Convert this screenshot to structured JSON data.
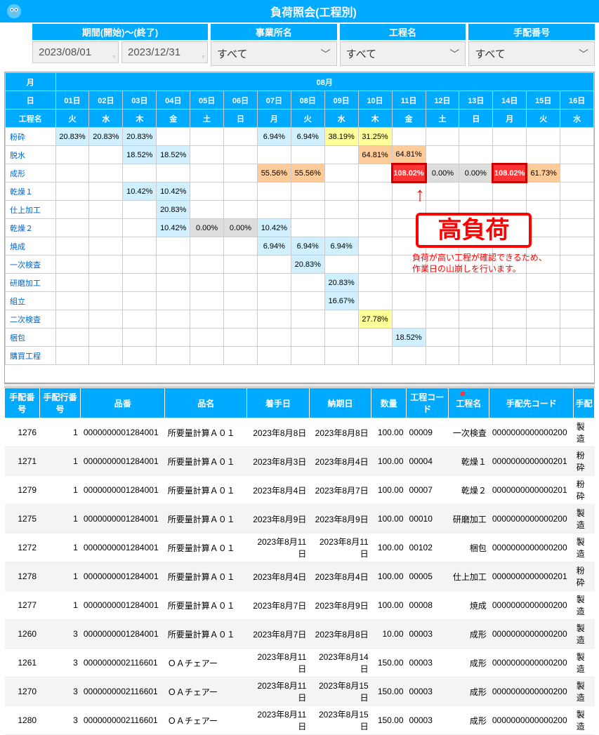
{
  "title": "負荷照会(工程別)",
  "filters": {
    "period_label": "期間(開始)～(終了)",
    "period_start": "2023/08/01",
    "period_end": "2023/12/31",
    "office_label": "事業所名",
    "office_value": "すべて",
    "process_label": "工程名",
    "process_value": "すべて",
    "order_label": "手配番号",
    "order_value": "すべて"
  },
  "calendar": {
    "month_header": "月",
    "month_value": "08月",
    "day_header": "日",
    "proc_header": "工程名",
    "days": [
      "01日",
      "02日",
      "03日",
      "04日",
      "05日",
      "06日",
      "07日",
      "08日",
      "09日",
      "10日",
      "11日",
      "12日",
      "13日",
      "14日",
      "15日",
      "16日"
    ],
    "dows": [
      "火",
      "水",
      "木",
      "金",
      "土",
      "日",
      "月",
      "火",
      "水",
      "木",
      "金",
      "土",
      "日",
      "月",
      "火",
      "水"
    ]
  },
  "rows": [
    {
      "name": "粉砕",
      "cells": [
        [
          "20.83%",
          "c-ltblue"
        ],
        [
          "20.83%",
          "c-ltblue"
        ],
        [
          "20.83%",
          "c-ltblue"
        ],
        [
          "",
          ""
        ],
        [
          "",
          ""
        ],
        [
          "",
          ""
        ],
        [
          "6.94%",
          "c-ltblue"
        ],
        [
          "6.94%",
          "c-ltblue"
        ],
        [
          "38.19%",
          "c-yellow"
        ],
        [
          "31.25%",
          "c-yellow"
        ],
        [
          "",
          ""
        ],
        [
          "",
          ""
        ],
        [
          "",
          ""
        ],
        [
          "",
          ""
        ],
        [
          "",
          ""
        ],
        [
          "",
          ""
        ]
      ]
    },
    {
      "name": "脱水",
      "cells": [
        [
          "",
          ""
        ],
        [
          "",
          ""
        ],
        [
          "18.52%",
          "c-ltblue"
        ],
        [
          "18.52%",
          "c-ltblue"
        ],
        [
          "",
          ""
        ],
        [
          "",
          ""
        ],
        [
          "",
          ""
        ],
        [
          "",
          ""
        ],
        [
          "",
          ""
        ],
        [
          "64.81%",
          "c-orange"
        ],
        [
          "64.81%",
          "c-orange"
        ],
        [
          "",
          ""
        ],
        [
          "",
          ""
        ],
        [
          "",
          ""
        ],
        [
          "",
          ""
        ],
        [
          "",
          ""
        ]
      ]
    },
    {
      "name": "成形",
      "cells": [
        [
          "",
          ""
        ],
        [
          "",
          ""
        ],
        [
          "",
          ""
        ],
        [
          "",
          ""
        ],
        [
          "",
          ""
        ],
        [
          "",
          ""
        ],
        [
          "55.56%",
          "c-orange"
        ],
        [
          "55.56%",
          "c-orange"
        ],
        [
          "",
          ""
        ],
        [
          "",
          ""
        ],
        [
          "108.02%",
          "c-red"
        ],
        [
          "0.00%",
          "c-gray"
        ],
        [
          "0.00%",
          "c-gray"
        ],
        [
          "108.02%",
          "c-red"
        ],
        [
          "61.73%",
          "c-orange"
        ],
        [
          "",
          ""
        ]
      ]
    },
    {
      "name": "乾燥１",
      "cells": [
        [
          "",
          ""
        ],
        [
          "",
          ""
        ],
        [
          "10.42%",
          "c-ltblue"
        ],
        [
          "10.42%",
          "c-ltblue"
        ],
        [
          "",
          ""
        ],
        [
          "",
          ""
        ],
        [
          "",
          ""
        ],
        [
          "",
          ""
        ],
        [
          "",
          ""
        ],
        [
          "",
          ""
        ],
        [
          "",
          ""
        ],
        [
          "",
          ""
        ],
        [
          "",
          ""
        ],
        [
          "",
          ""
        ],
        [
          "",
          ""
        ],
        [
          "",
          ""
        ]
      ]
    },
    {
      "name": "仕上加工",
      "cells": [
        [
          "",
          ""
        ],
        [
          "",
          ""
        ],
        [
          "",
          ""
        ],
        [
          "20.83%",
          "c-ltblue"
        ],
        [
          "",
          ""
        ],
        [
          "",
          ""
        ],
        [
          "",
          ""
        ],
        [
          "",
          ""
        ],
        [
          "",
          ""
        ],
        [
          "",
          ""
        ],
        [
          "",
          ""
        ],
        [
          "",
          ""
        ],
        [
          "",
          ""
        ],
        [
          "",
          ""
        ],
        [
          "",
          ""
        ],
        [
          "",
          ""
        ]
      ]
    },
    {
      "name": "乾燥２",
      "cells": [
        [
          "",
          ""
        ],
        [
          "",
          ""
        ],
        [
          "",
          ""
        ],
        [
          "10.42%",
          "c-ltblue"
        ],
        [
          "0.00%",
          "c-gray"
        ],
        [
          "0.00%",
          "c-gray"
        ],
        [
          "10.42%",
          "c-ltblue"
        ],
        [
          "",
          ""
        ],
        [
          "",
          ""
        ],
        [
          "",
          ""
        ],
        [
          "",
          ""
        ],
        [
          "",
          ""
        ],
        [
          "",
          ""
        ],
        [
          "",
          ""
        ],
        [
          "",
          ""
        ],
        [
          "",
          ""
        ]
      ]
    },
    {
      "name": "焼成",
      "cells": [
        [
          "",
          ""
        ],
        [
          "",
          ""
        ],
        [
          "",
          ""
        ],
        [
          "",
          ""
        ],
        [
          "",
          ""
        ],
        [
          "",
          ""
        ],
        [
          "6.94%",
          "c-ltblue"
        ],
        [
          "6.94%",
          "c-ltblue"
        ],
        [
          "6.94%",
          "c-ltblue"
        ],
        [
          "",
          ""
        ],
        [
          "",
          ""
        ],
        [
          "",
          ""
        ],
        [
          "",
          ""
        ],
        [
          "",
          ""
        ],
        [
          "",
          ""
        ],
        [
          "",
          ""
        ]
      ]
    },
    {
      "name": "一次検査",
      "cells": [
        [
          "",
          ""
        ],
        [
          "",
          ""
        ],
        [
          "",
          ""
        ],
        [
          "",
          ""
        ],
        [
          "",
          ""
        ],
        [
          "",
          ""
        ],
        [
          "",
          ""
        ],
        [
          "20.83%",
          "c-ltblue"
        ],
        [
          "",
          ""
        ],
        [
          "",
          ""
        ],
        [
          "",
          ""
        ],
        [
          "",
          ""
        ],
        [
          "",
          ""
        ],
        [
          "",
          ""
        ],
        [
          "",
          ""
        ],
        [
          "",
          ""
        ]
      ]
    },
    {
      "name": "研磨加工",
      "cells": [
        [
          "",
          ""
        ],
        [
          "",
          ""
        ],
        [
          "",
          ""
        ],
        [
          "",
          ""
        ],
        [
          "",
          ""
        ],
        [
          "",
          ""
        ],
        [
          "",
          ""
        ],
        [
          "",
          ""
        ],
        [
          "20.83%",
          "c-ltblue"
        ],
        [
          "",
          ""
        ],
        [
          "",
          ""
        ],
        [
          "",
          ""
        ],
        [
          "",
          ""
        ],
        [
          "",
          ""
        ],
        [
          "",
          ""
        ],
        [
          "",
          ""
        ]
      ]
    },
    {
      "name": "組立",
      "cells": [
        [
          "",
          ""
        ],
        [
          "",
          ""
        ],
        [
          "",
          ""
        ],
        [
          "",
          ""
        ],
        [
          "",
          ""
        ],
        [
          "",
          ""
        ],
        [
          "",
          ""
        ],
        [
          "",
          ""
        ],
        [
          "16.67%",
          "c-ltblue"
        ],
        [
          "",
          ""
        ],
        [
          "",
          ""
        ],
        [
          "",
          ""
        ],
        [
          "",
          ""
        ],
        [
          "",
          ""
        ],
        [
          "",
          ""
        ],
        [
          "",
          ""
        ]
      ]
    },
    {
      "name": "二次検査",
      "cells": [
        [
          "",
          ""
        ],
        [
          "",
          ""
        ],
        [
          "",
          ""
        ],
        [
          "",
          ""
        ],
        [
          "",
          ""
        ],
        [
          "",
          ""
        ],
        [
          "",
          ""
        ],
        [
          "",
          ""
        ],
        [
          "",
          ""
        ],
        [
          "27.78%",
          "c-yellow"
        ],
        [
          "",
          ""
        ],
        [
          "",
          ""
        ],
        [
          "",
          ""
        ],
        [
          "",
          ""
        ],
        [
          "",
          ""
        ],
        [
          "",
          ""
        ]
      ]
    },
    {
      "name": "梱包",
      "cells": [
        [
          "",
          ""
        ],
        [
          "",
          ""
        ],
        [
          "",
          ""
        ],
        [
          "",
          ""
        ],
        [
          "",
          ""
        ],
        [
          "",
          ""
        ],
        [
          "",
          ""
        ],
        [
          "",
          ""
        ],
        [
          "",
          ""
        ],
        [
          "",
          ""
        ],
        [
          "18.52%",
          "c-ltblue"
        ],
        [
          "",
          ""
        ],
        [
          "",
          ""
        ],
        [
          "",
          ""
        ],
        [
          "",
          ""
        ],
        [
          "",
          ""
        ]
      ]
    },
    {
      "name": "購買工程",
      "cells": [
        [
          "",
          ""
        ],
        [
          "",
          ""
        ],
        [
          "",
          ""
        ],
        [
          "",
          ""
        ],
        [
          "",
          ""
        ],
        [
          "",
          ""
        ],
        [
          "",
          ""
        ],
        [
          "",
          ""
        ],
        [
          "",
          ""
        ],
        [
          "",
          ""
        ],
        [
          "",
          ""
        ],
        [
          "",
          ""
        ],
        [
          "",
          ""
        ],
        [
          "",
          ""
        ],
        [
          "",
          ""
        ],
        [
          "",
          ""
        ]
      ]
    }
  ],
  "annot": {
    "big": "高負荷",
    "text1": "負荷が高い工程が確認できるため、",
    "text2": "作業日の山崩しを行います。"
  },
  "detail_headers": [
    "手配番号",
    "手配行番号",
    "品番",
    "品名",
    "着手日",
    "納期日",
    "数量",
    "工程コード",
    "工程名",
    "手配先コード",
    "手配"
  ],
  "detail_rows": [
    [
      "1276",
      "1",
      "0000000001284001",
      "所要量計算Ａ０１",
      "2023年8月8日",
      "2023年8月8日",
      "100.00",
      "00009",
      "一次検査",
      "0000000000000200",
      "製造"
    ],
    [
      "1271",
      "1",
      "0000000001284001",
      "所要量計算Ａ０１",
      "2023年8月3日",
      "2023年8月4日",
      "100.00",
      "00004",
      "乾燥１",
      "0000000000000201",
      "粉砕"
    ],
    [
      "1279",
      "1",
      "0000000001284001",
      "所要量計算Ａ０１",
      "2023年8月4日",
      "2023年8月7日",
      "100.00",
      "00007",
      "乾燥２",
      "0000000000000201",
      "粉砕"
    ],
    [
      "1275",
      "1",
      "0000000001284001",
      "所要量計算Ａ０１",
      "2023年8月9日",
      "2023年8月9日",
      "100.00",
      "00010",
      "研磨加工",
      "0000000000000200",
      "製造"
    ],
    [
      "1272",
      "1",
      "0000000001284001",
      "所要量計算Ａ０１",
      "2023年8月11日",
      "2023年8月11日",
      "100.00",
      "00102",
      "梱包",
      "0000000000000200",
      "製造"
    ],
    [
      "1278",
      "1",
      "0000000001284001",
      "所要量計算Ａ０１",
      "2023年8月4日",
      "2023年8月4日",
      "100.00",
      "00005",
      "仕上加工",
      "0000000000000201",
      "粉砕"
    ],
    [
      "1277",
      "1",
      "0000000001284001",
      "所要量計算Ａ０１",
      "2023年8月7日",
      "2023年8月9日",
      "100.00",
      "00008",
      "焼成",
      "0000000000000200",
      "製造"
    ],
    [
      "1260",
      "3",
      "0000000001284001",
      "所要量計算Ａ０１",
      "2023年8月7日",
      "2023年8月8日",
      "10.00",
      "00003",
      "成形",
      "0000000000000200",
      "製造"
    ],
    [
      "1261",
      "3",
      "0000000002116601",
      "ＯＡチェアー",
      "2023年8月11日",
      "2023年8月14日",
      "150.00",
      "00003",
      "成形",
      "0000000000000200",
      "製造"
    ],
    [
      "1270",
      "3",
      "0000000002116601",
      "ＯＡチェアー",
      "2023年8月11日",
      "2023年8月15日",
      "150.00",
      "00003",
      "成形",
      "0000000000000200",
      "製造"
    ],
    [
      "1280",
      "3",
      "0000000002116601",
      "ＯＡチェアー",
      "2023年8月11日",
      "2023年8月15日",
      "150.00",
      "00003",
      "成形",
      "0000000000000200",
      "製造"
    ]
  ]
}
